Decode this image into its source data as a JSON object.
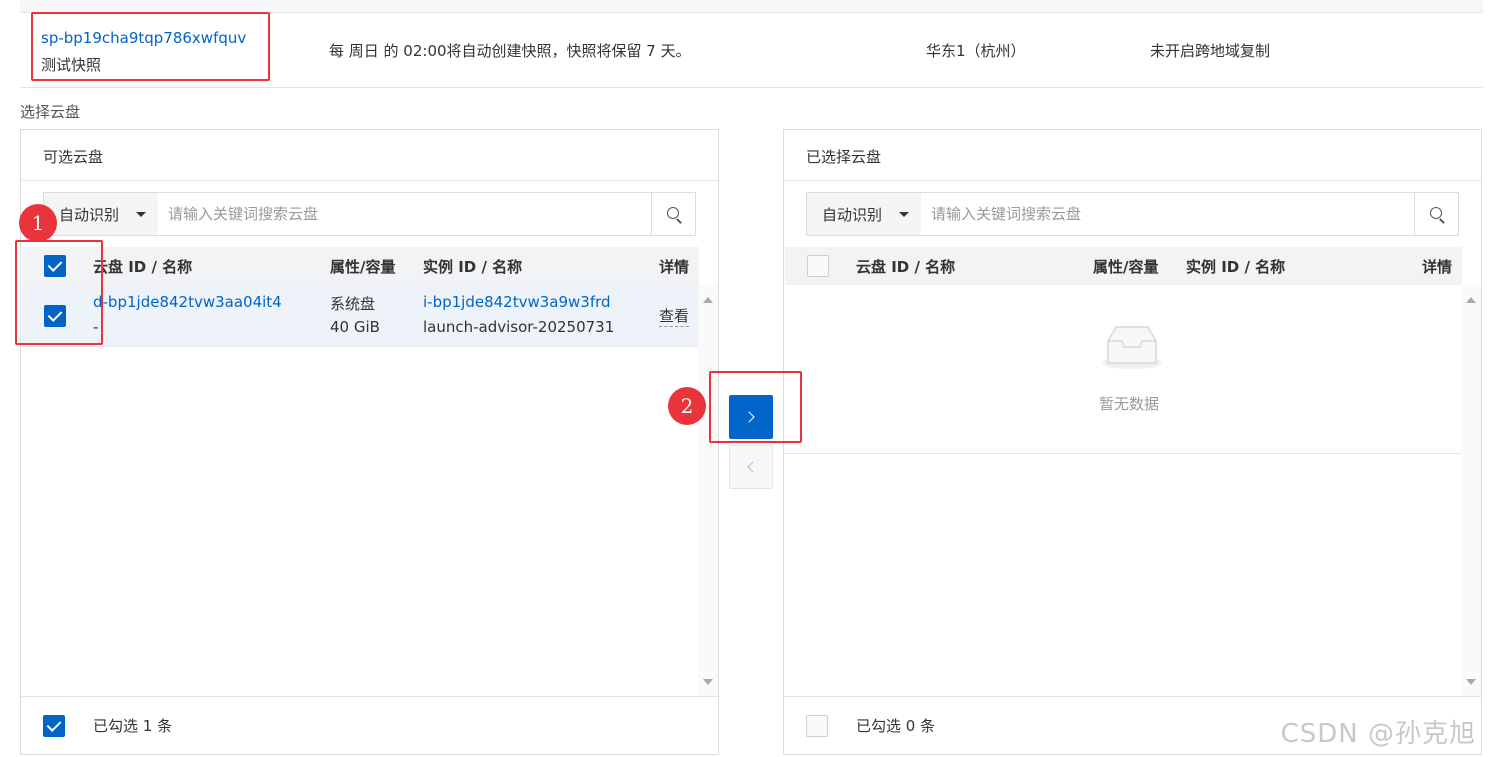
{
  "policy": {
    "snapshot_id": "sp-bp19cha9tqp786xwfquv",
    "snapshot_name": "测试快照",
    "schedule": "每 周日 的 02:00将自动创建快照，快照将保留 7 天。",
    "region": "华东1（杭州）",
    "replication": "未开启跨地域复制"
  },
  "section_label": "选择云盘",
  "left_panel": {
    "title": "可选云盘",
    "search": {
      "mode": "自动识别",
      "placeholder": "请输入关键词搜索云盘"
    },
    "columns": [
      "云盘 ID / 名称",
      "属性/容量",
      "实例 ID / 名称",
      "详情"
    ],
    "rows": [
      {
        "checked": true,
        "disk_id": "d-bp1jde842tvw3aa04it4",
        "disk_name": "-",
        "attr": "系统盘",
        "capacity": "40 GiB",
        "instance_id": "i-bp1jde842tvw3a9w3frd",
        "instance_name": "launch-advisor-20250731",
        "detail": "查看"
      }
    ],
    "footer": "已勾选 1 条"
  },
  "right_panel": {
    "title": "已选择云盘",
    "search": {
      "mode": "自动识别",
      "placeholder": "请输入关键词搜索云盘"
    },
    "columns": [
      "云盘 ID / 名称",
      "属性/容量",
      "实例 ID / 名称",
      "详情"
    ],
    "empty_text": "暂无数据",
    "footer": "已勾选 0 条"
  },
  "badges": [
    "1",
    "2"
  ],
  "watermark": "CSDN @孙克旭",
  "colors": {
    "primary": "#0064c8",
    "highlight": "#e8343a"
  }
}
